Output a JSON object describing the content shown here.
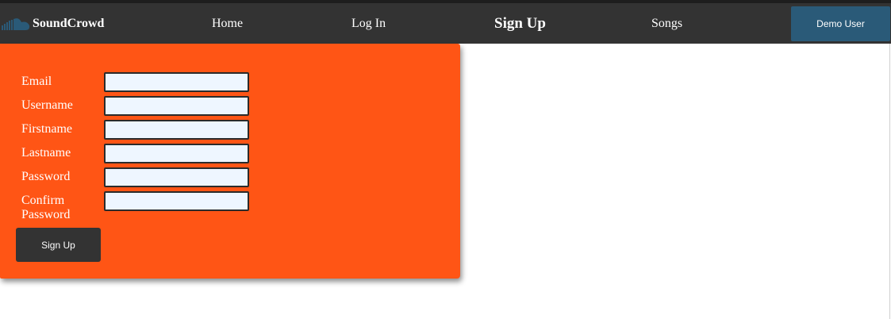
{
  "brand": {
    "name": "SoundCrowd",
    "icon": "soundcloud-logo-icon"
  },
  "nav": {
    "home": "Home",
    "login": "Log In",
    "signup": "Sign Up",
    "songs": "Songs",
    "demo": "Demo User"
  },
  "colors": {
    "navbar": "#333333",
    "accent": "#ff5515",
    "demo_button": "#2a5a78",
    "input_bg": "#eef6ff"
  },
  "form": {
    "email_label": "Email",
    "username_label": "Username",
    "firstname_label": "Firstname",
    "lastname_label": "Lastname",
    "password_label": "Password",
    "confirm_label": "Confirm Password",
    "values": {
      "email": "",
      "username": "",
      "firstname": "",
      "lastname": "",
      "password": "",
      "confirm": ""
    },
    "submit_label": "Sign Up"
  }
}
